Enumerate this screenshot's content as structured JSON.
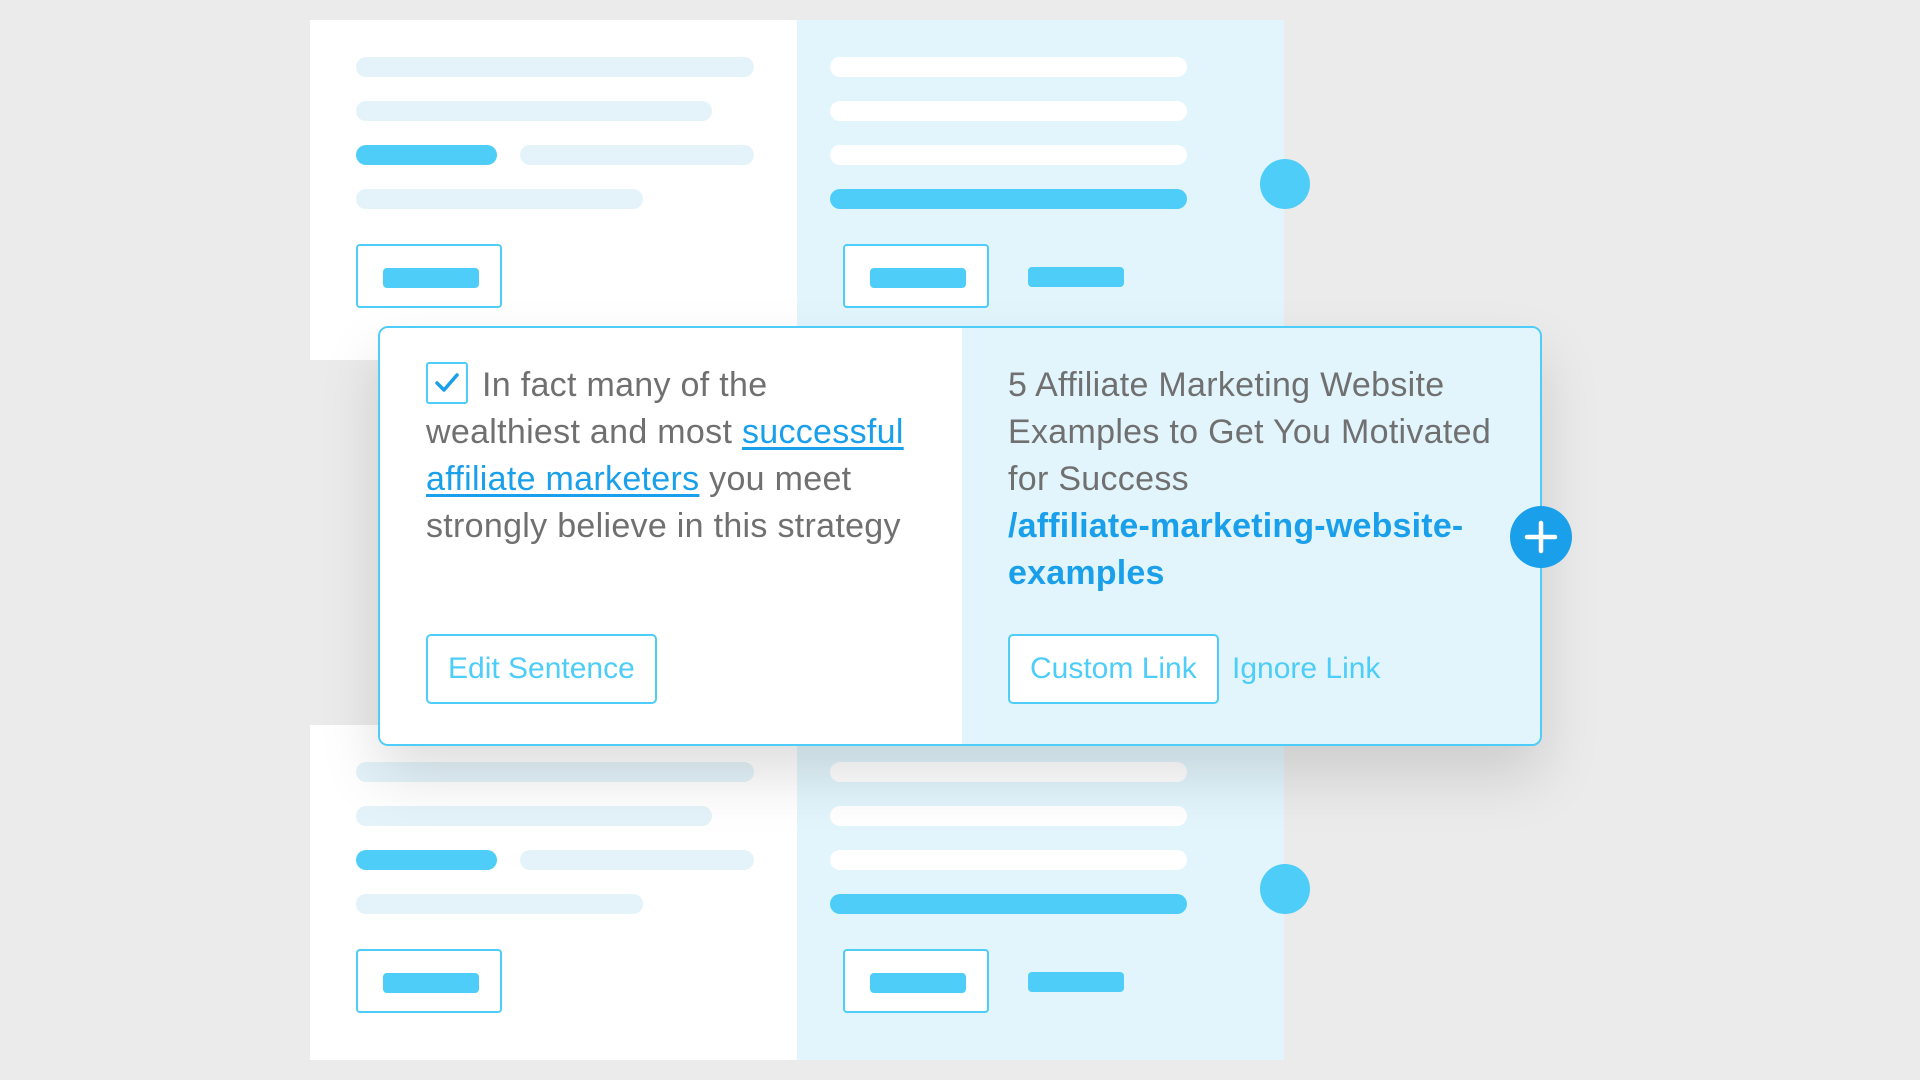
{
  "suggestion": {
    "sentence_before": "In fact many of the wealthiest and most",
    "link_text": "successful affiliate marketers",
    "sentence_after": "you meet strongly believe in this strategy",
    "checked": true,
    "edit_button": "Edit Sentence",
    "target_title": "5 Affiliate Marketing Website Examples to Get You Motivated for Success",
    "target_url": "/affiliate-marketing-website-examples",
    "custom_link_button": "Custom Link",
    "ignore_link_button": "Ignore Link"
  },
  "icons": {
    "checkbox": "check-icon",
    "add": "plus-icon"
  },
  "colors": {
    "accent": "#4dcdf8",
    "link": "#1aa0ea",
    "panel_right_bg": "#e2f5fc",
    "text": "#707070",
    "background": "#ebebeb"
  }
}
